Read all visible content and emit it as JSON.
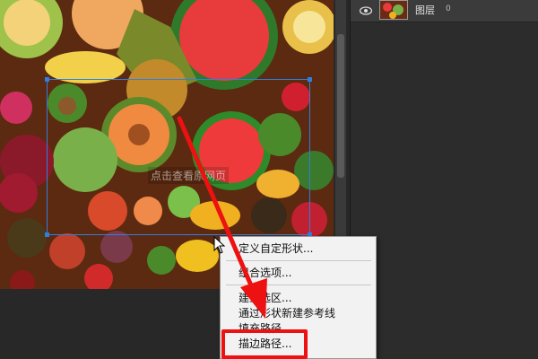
{
  "layers_panel": {
    "layer_name": "图层",
    "layer_index": "0"
  },
  "watermark": "点击查看原网页",
  "context_menu": {
    "items": [
      "定义自定形状...",
      "组合选项...",
      "建立选区...",
      "通过形状新建参考线",
      "填充路径...",
      "描边路径..."
    ]
  },
  "colors": {
    "selection": "#2f7fe0",
    "annotation_red": "#ee1111",
    "menu_bg": "#f2f2f2",
    "panel_bg": "#2c2c2c"
  }
}
